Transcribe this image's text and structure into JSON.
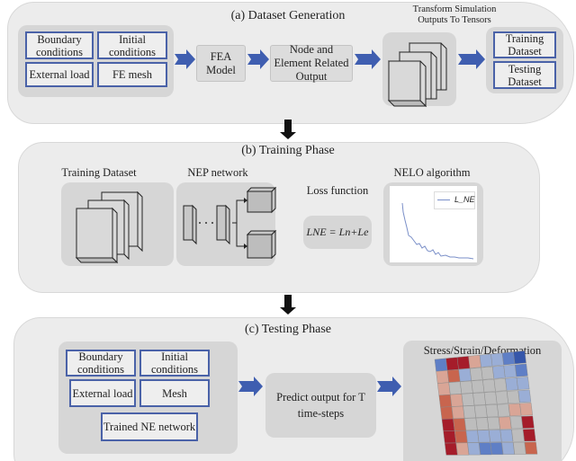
{
  "panel_a": {
    "title": "(a)  Dataset Generation",
    "inputs": [
      "Boundary conditions",
      "Initial conditions",
      "External load",
      "FE mesh"
    ],
    "fea": "FEA Model",
    "output": "Node and Element Related Output",
    "transform_title_1": "Transform Simulation",
    "transform_title_2": "Outputs To Tensors",
    "training": "Training Dataset",
    "testing": "Testing Dataset"
  },
  "panel_b": {
    "title": "(b)   Training Phase",
    "training_dataset": "Training Dataset",
    "nep": "NEP network",
    "loss_title": "Loss function",
    "loss_formula": "LNE = Ln+Le",
    "nelo": "NELO algorithm",
    "legend": "L_NE",
    "line_color": "#7a8fc8"
  },
  "panel_c": {
    "title": "(c)    Testing Phase",
    "inputs": [
      "Boundary conditions",
      "Initial conditions",
      "External load",
      "Mesh",
      "Trained NE network"
    ],
    "predict": "Predict output for T time-steps",
    "result_title": "Stress/Strain/Deformation"
  },
  "colors": {
    "arrow": "#3f5eb0",
    "box_border": "#4a62a8"
  }
}
